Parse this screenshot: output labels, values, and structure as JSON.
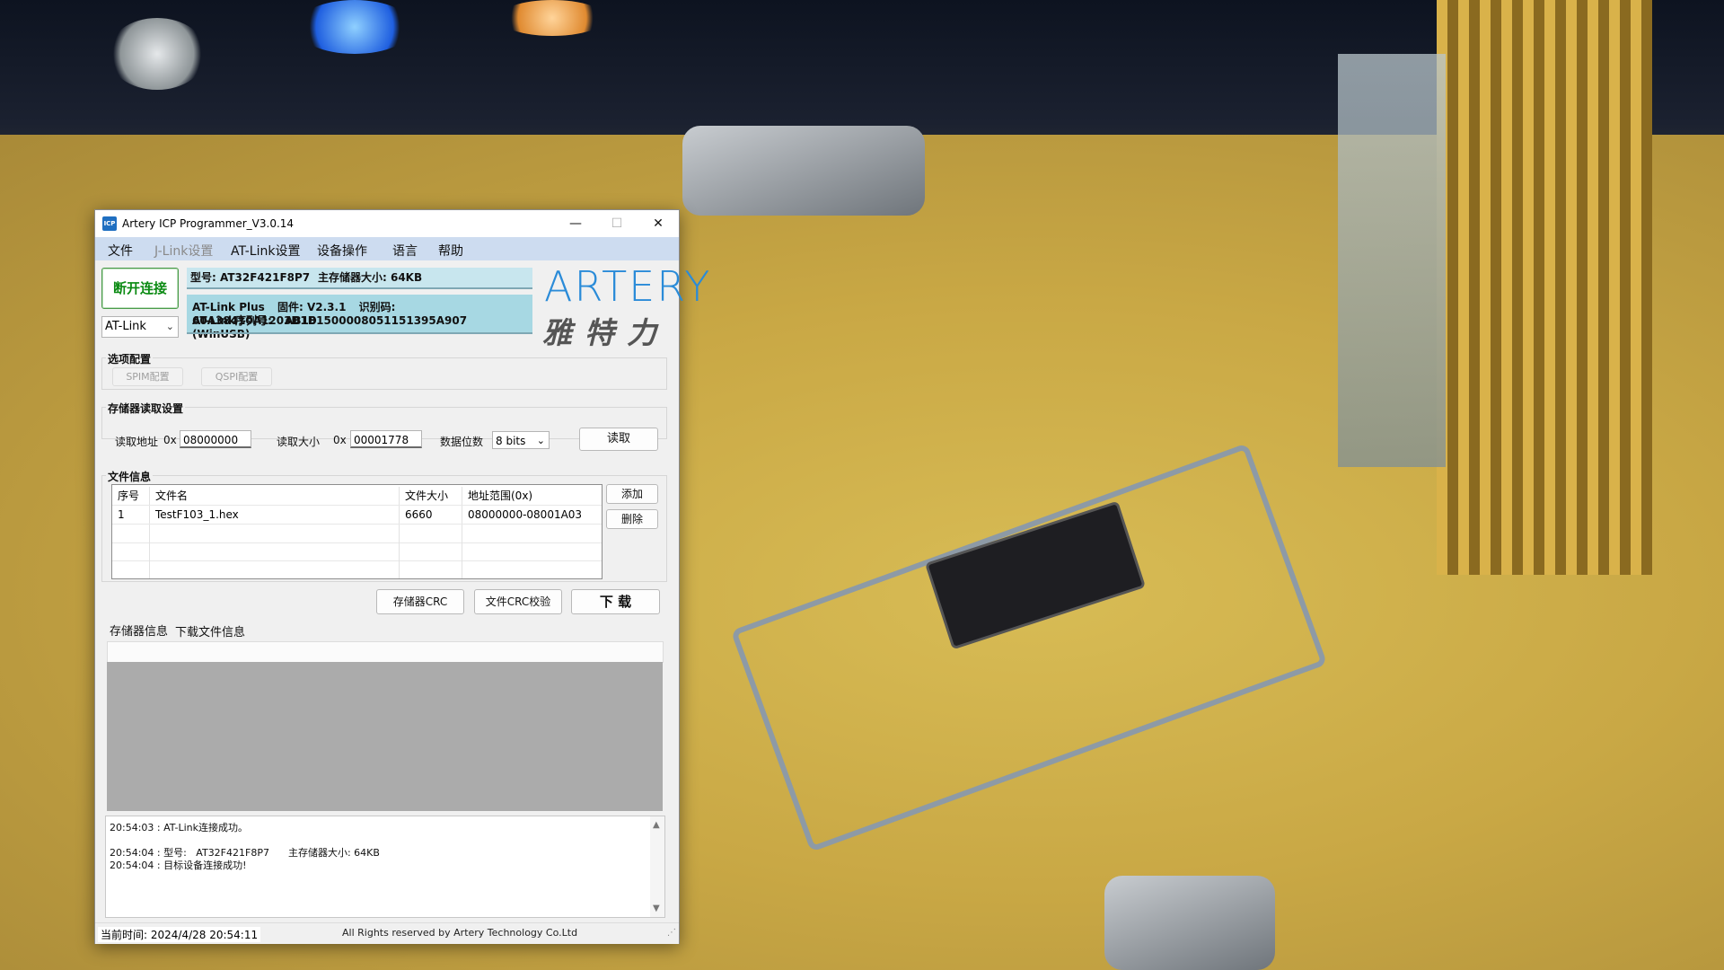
{
  "window": {
    "title": "Artery ICP Programmer_V3.0.14",
    "icon_label": "ICP",
    "controls": {
      "minimize": "—",
      "maximize": "☐",
      "close": "✕"
    }
  },
  "menu": {
    "file": "文件",
    "jlink": "J-Link设置",
    "atlink": "AT-Link设置",
    "device": "设备操作",
    "language": "语言",
    "help": "帮助"
  },
  "connection": {
    "disconnect_label": "断开连接",
    "probe_value": "AT-Link",
    "model_text": "型号:  AT32F421F8P7",
    "flash_size_text": "主存储器大小: 64KB",
    "probe_line": [
      "AT-Link Plus",
      "固件: V2.3.1",
      "识别码: 60A38410A1203D1D"
    ],
    "serial_line": [
      "AT-Link序列号:",
      "AB181500008051151395A907",
      "(WinUSB)"
    ]
  },
  "logo": {
    "text": "ARTERY",
    "cn": "雅特力",
    "color": "#2a8bd8"
  },
  "options": {
    "title": "选项配置",
    "spim_label": "SPIM配置",
    "qspi_label": "QSPI配置"
  },
  "memory_read": {
    "title": "存储器读取设置",
    "addr_label": "读取地址",
    "addr_prefix": "0x",
    "addr_value": "08000000",
    "size_label": "读取大小",
    "size_prefix": "0x",
    "size_value": "00001778",
    "width_label": "数据位数",
    "width_value": "8 bits",
    "read_label": "读取"
  },
  "file_info": {
    "title": "文件信息",
    "columns": [
      "序号",
      "文件名",
      "文件大小",
      "地址范围(0x)"
    ],
    "rows": [
      [
        "1",
        "TestF103_1.hex",
        "6660",
        "08000000-08001A03"
      ]
    ],
    "add_label": "添加",
    "delete_label": "删除"
  },
  "actions": {
    "crc_label": "存储器CRC",
    "file_crc_label": "文件CRC校验",
    "download_label": "下 载"
  },
  "tabs": {
    "memory_info": "存储器信息",
    "download_info": "下载文件信息"
  },
  "log": {
    "lines": [
      "20:54:03 : AT-Link连接成功。",
      "20:54:04 : 型号:   AT32F421F8P7      主存储器大小: 64KB",
      "20:54:04 : 目标设备连接成功!"
    ]
  },
  "status": {
    "time_text": "当前时间:  2024/4/28 20:54:11",
    "copyright": "All Rights reserved by Artery Technology Co.Ltd"
  }
}
